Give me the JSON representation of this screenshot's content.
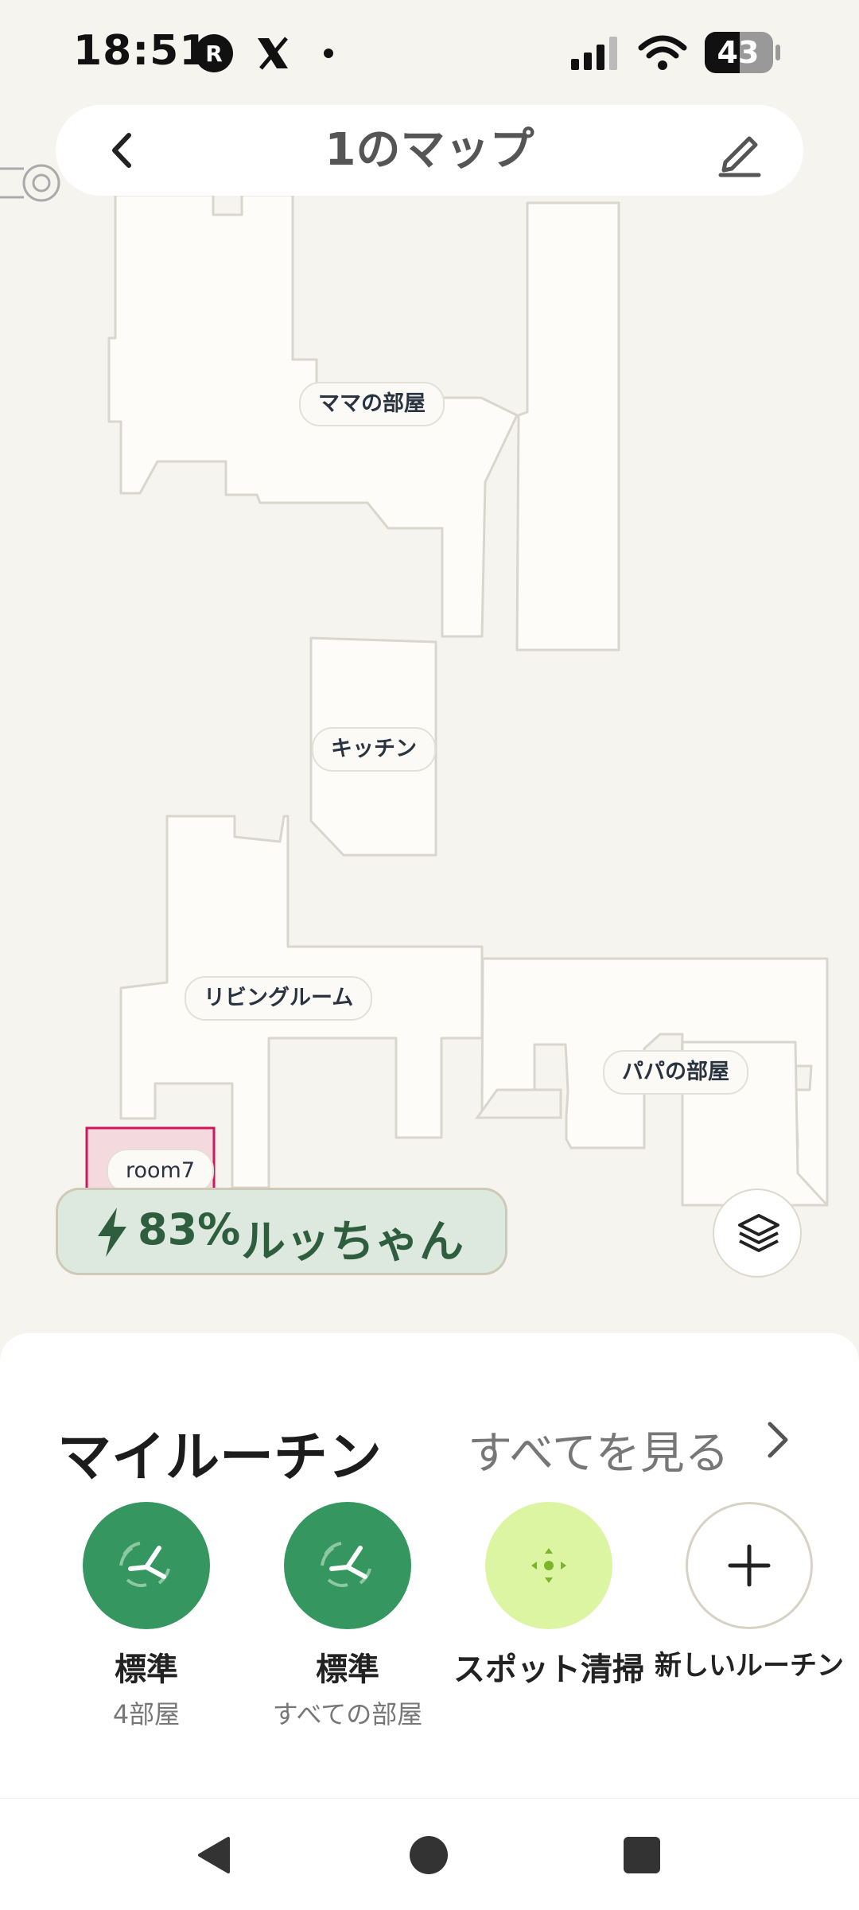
{
  "status_bar": {
    "time": "18:51",
    "battery": "43",
    "icons": [
      "r-app-icon",
      "x-app-icon",
      "notification-dot-icon",
      "signal-icon",
      "wifi-icon",
      "battery-icon"
    ]
  },
  "header": {
    "title": "1のマップ",
    "back_icon": "chevron-left-icon",
    "edit_icon": "pencil-icon"
  },
  "map": {
    "rooms": [
      {
        "label": "ママの部屋"
      },
      {
        "label": "キッチン"
      },
      {
        "label": "リビングルーム"
      },
      {
        "label": "パパの部屋"
      },
      {
        "label": "room7"
      }
    ]
  },
  "robot": {
    "battery": "83%",
    "name": "ルッちゃん",
    "icon": "bolt-icon"
  },
  "routines": {
    "title": "マイルーチン",
    "see_all": "すべてを見る",
    "items": [
      {
        "label": "標準",
        "sub": "4部屋",
        "color": "#35965f"
      },
      {
        "label": "標準",
        "sub": "すべての部屋",
        "color": "#35965f"
      },
      {
        "label": "スポット清掃",
        "sub": "",
        "color": "#dcf5a2"
      },
      {
        "label": "新しいルーチン",
        "sub": "",
        "color": "#ffffff"
      }
    ]
  },
  "colors": {
    "accent_green": "#35965f",
    "spot_green": "#dcf5a2",
    "map_floor": "#fdfcf9",
    "map_bg": "#f6f4ef",
    "room7_highlight": "#d4145a"
  }
}
